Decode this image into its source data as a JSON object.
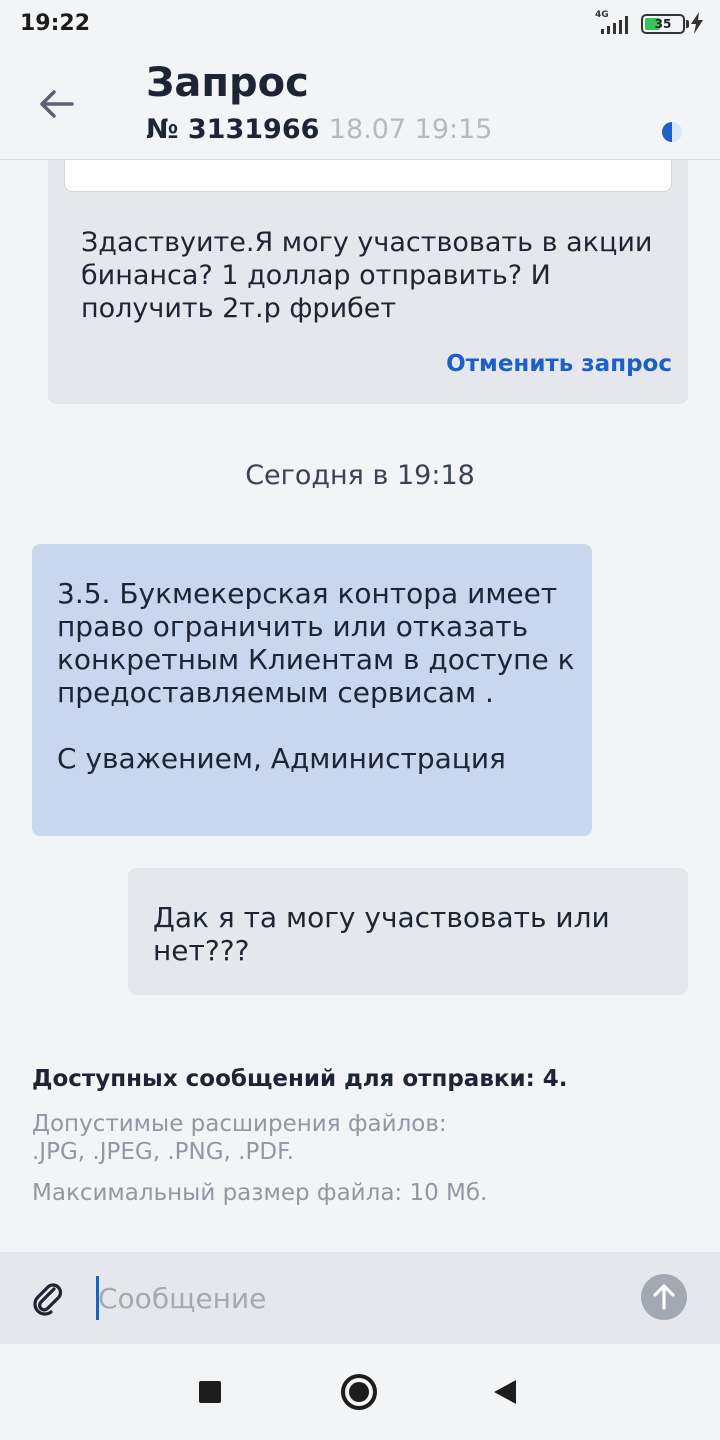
{
  "status_bar": {
    "time": "19:22",
    "network": "4G",
    "battery": "35"
  },
  "header": {
    "title": "Запрос",
    "request_number": "№ 3131966",
    "request_date": "18.07 19:15"
  },
  "chat": {
    "first_message": "Здаствуите.Я могу участвовать в акции бинанса? 1 доллар отправить? И получить 2т.р фрибет",
    "cancel_label": "Отменить запрос",
    "date_separator": "Сегодня в 19:18",
    "admin_message": "3.5. Букмекерская контора имеет право ограничить или отказать конкретным Клиентам в доступе к предоставляемым сервисам .\n\nС уважением, Администрация",
    "user_message": "Дак я та могу участвовать или нет???"
  },
  "info": {
    "messages_left": "Доступных сообщений для отправки: 4.",
    "allowed_extensions": "Допустимые расширения файлов: .JPG, .JPEG, .PNG, .PDF.",
    "max_size": "Максимальный размер файла: 10 Мб."
  },
  "composer": {
    "placeholder": "Сообщение"
  },
  "colors": {
    "accent": "#1b5fc7",
    "admin_bubble": "#c8d7ee",
    "user_bubble": "#e5e7ec",
    "background": "#f3f4f6"
  }
}
